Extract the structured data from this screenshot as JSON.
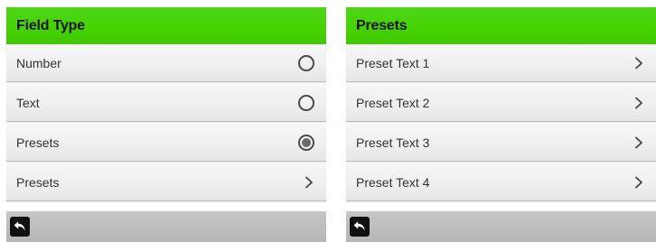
{
  "left_panel": {
    "title": "Field Type",
    "rows": [
      {
        "label": "Number",
        "control": "radio",
        "selected": false
      },
      {
        "label": "Text",
        "control": "radio",
        "selected": false
      },
      {
        "label": "Presets",
        "control": "radio",
        "selected": true
      },
      {
        "label": "Presets",
        "control": "chevron"
      }
    ],
    "footer_icon": "back-arrow-icon"
  },
  "right_panel": {
    "title": "Presets",
    "rows": [
      {
        "label": "Preset Text 1",
        "control": "chevron"
      },
      {
        "label": "Preset Text 2",
        "control": "chevron"
      },
      {
        "label": "Preset Text 3",
        "control": "chevron"
      },
      {
        "label": "Preset Text 4",
        "control": "chevron"
      }
    ],
    "footer_icon": "back-arrow-icon"
  },
  "colors": {
    "header_green": "#45d300",
    "row_bg": "#efefef",
    "footer_gray": "#bcbcbc"
  }
}
